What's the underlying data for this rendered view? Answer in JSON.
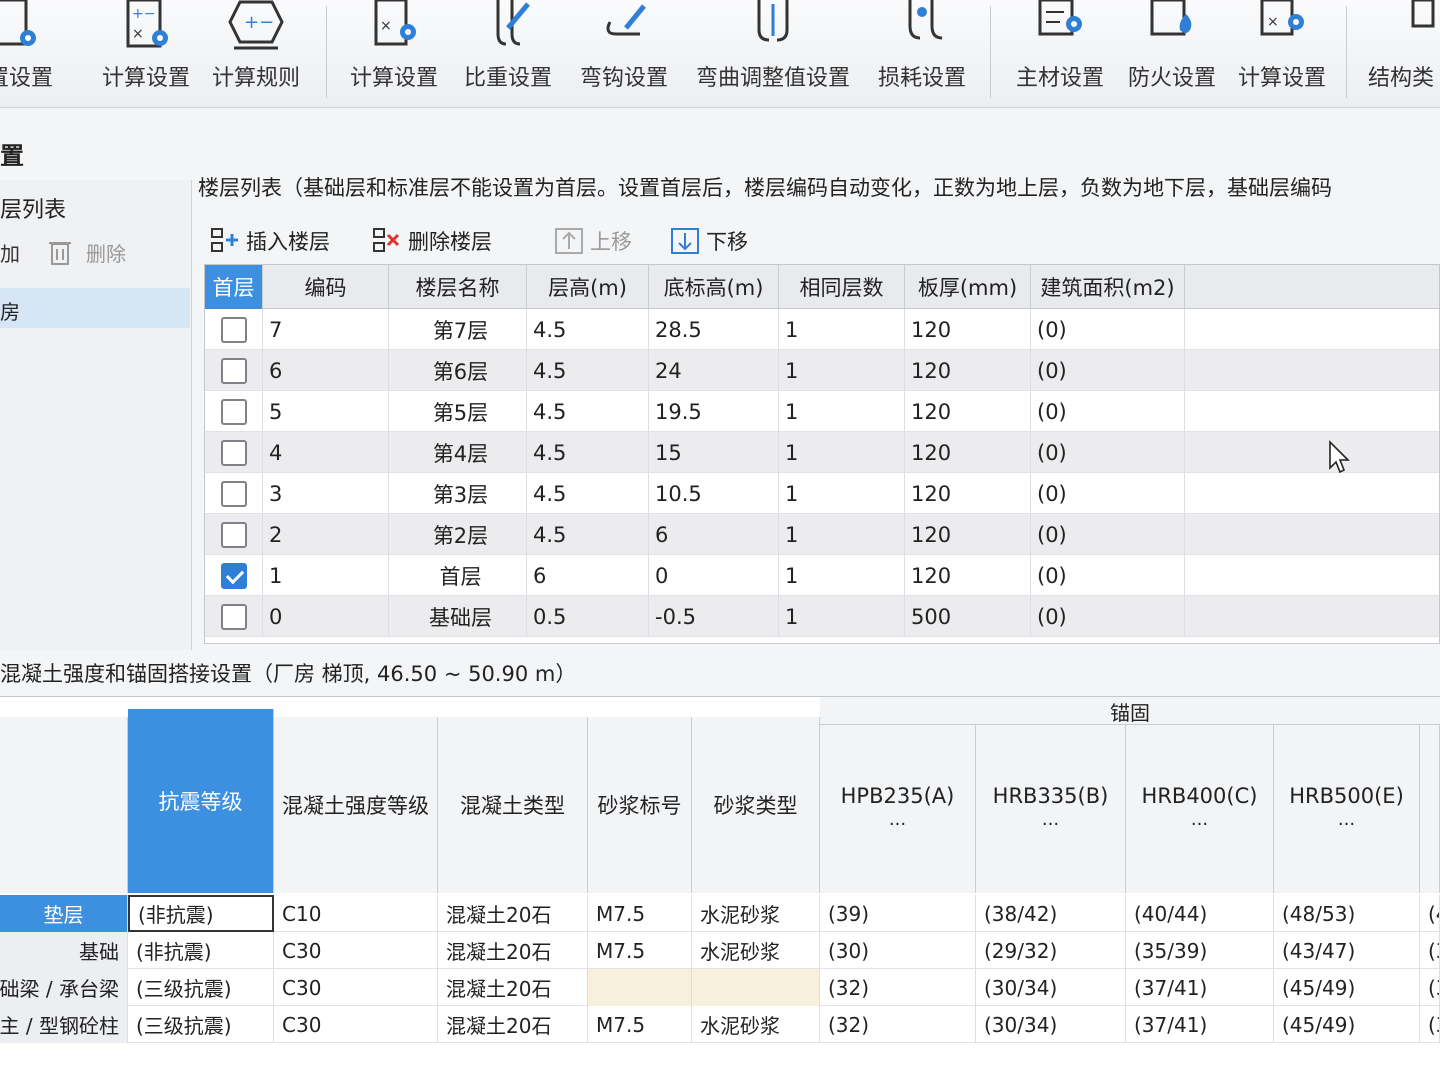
{
  "ribbon": {
    "buttons": [
      {
        "label": "置设置",
        "icon": "gear-doc-icon"
      },
      {
        "label": "计算设置",
        "icon": "calc-settings-icon"
      },
      {
        "label": "计算规则",
        "icon": "calc-rule-icon"
      },
      {
        "label": "计算设置",
        "icon": "calc-settings-icon"
      },
      {
        "label": "比重设置",
        "icon": "rebar-weight-icon"
      },
      {
        "label": "弯钩设置",
        "icon": "hook-icon"
      },
      {
        "label": "弯曲调整值设置",
        "icon": "bend-adjust-icon"
      },
      {
        "label": "损耗设置",
        "icon": "loss-icon"
      },
      {
        "label": "主材设置",
        "icon": "main-material-icon"
      },
      {
        "label": "防火设置",
        "icon": "fire-icon"
      },
      {
        "label": "计算设置",
        "icon": "calc-settings-icon"
      },
      {
        "label": "结构类",
        "icon": "structure-icon"
      }
    ]
  },
  "section_title": "置",
  "left_panel": {
    "title": "层列表",
    "add_label": "加",
    "delete_label": "删除",
    "selected_item": "房"
  },
  "floor_notice": "楼层列表（基础层和标准层不能设置为首层。设置首层后，楼层编码自动变化，正数为地上层，负数为地下层，基础层编码",
  "floor_toolbar": {
    "insert": "插入楼层",
    "delete": "删除楼层",
    "up": "上移",
    "down": "下移"
  },
  "floor_table": {
    "headers": [
      "首层",
      "编码",
      "楼层名称",
      "层高(m)",
      "底标高(m)",
      "相同层数",
      "板厚(mm)",
      "建筑面积(m2)"
    ],
    "rows": [
      {
        "first": false,
        "code": "7",
        "name": "第7层",
        "height": "4.5",
        "base": "28.5",
        "same": "1",
        "slab": "120",
        "area": "(0)"
      },
      {
        "first": false,
        "code": "6",
        "name": "第6层",
        "height": "4.5",
        "base": "24",
        "same": "1",
        "slab": "120",
        "area": "(0)"
      },
      {
        "first": false,
        "code": "5",
        "name": "第5层",
        "height": "4.5",
        "base": "19.5",
        "same": "1",
        "slab": "120",
        "area": "(0)"
      },
      {
        "first": false,
        "code": "4",
        "name": "第4层",
        "height": "4.5",
        "base": "15",
        "same": "1",
        "slab": "120",
        "area": "(0)"
      },
      {
        "first": false,
        "code": "3",
        "name": "第3层",
        "height": "4.5",
        "base": "10.5",
        "same": "1",
        "slab": "120",
        "area": "(0)"
      },
      {
        "first": false,
        "code": "2",
        "name": "第2层",
        "height": "4.5",
        "base": "6",
        "same": "1",
        "slab": "120",
        "area": "(0)"
      },
      {
        "first": true,
        "code": "1",
        "name": "首层",
        "height": "6",
        "base": "0",
        "same": "1",
        "slab": "120",
        "area": "(0)"
      },
      {
        "first": false,
        "code": "0",
        "name": "基础层",
        "height": "0.5",
        "base": "-0.5",
        "same": "1",
        "slab": "500",
        "area": "(0)"
      }
    ]
  },
  "concrete": {
    "title": "混凝土强度和锚固搭接设置（厂房  梯顶, 46.50 ~ 50.90 m）",
    "group_label": "锚固",
    "headers": {
      "seismic": "抗震等级",
      "strength": "混凝土强度等级",
      "type": "混凝土类型",
      "mortar_grade": "砂浆标号",
      "mortar_type": "砂浆类型",
      "hpb235": "HPB235(A)",
      "hrb335": "HRB335(B)",
      "hrb400": "HRB400(C)",
      "hrb500": "HRB500(E)",
      "dots": "···"
    },
    "rows": [
      {
        "name": "垫层",
        "seismic": "(非抗震)",
        "strength": "C10",
        "type": "混凝土20石",
        "mortar_grade": "M7.5",
        "mortar_type": "水泥砂浆",
        "a": "(39)",
        "b": "(38/42)",
        "c": "(40/44)",
        "e": "(48/53)",
        "more": "(4"
      },
      {
        "name": "基础",
        "seismic": "(非抗震)",
        "strength": "C30",
        "type": "混凝土20石",
        "mortar_grade": "M7.5",
        "mortar_type": "水泥砂浆",
        "a": "(30)",
        "b": "(29/32)",
        "c": "(35/39)",
        "e": "(43/47)",
        "more": "(3"
      },
      {
        "name": "础梁 / 承台梁",
        "seismic": "(三级抗震)",
        "strength": "C30",
        "type": "混凝土20石",
        "mortar_grade": "",
        "mortar_type": "",
        "a": "(32)",
        "b": "(30/34)",
        "c": "(37/41)",
        "e": "(45/49)",
        "more": "(3"
      },
      {
        "name": "主 / 型钢砼柱",
        "seismic": "(三级抗震)",
        "strength": "C30",
        "type": "混凝土20石",
        "mortar_grade": "M7.5",
        "mortar_type": "水泥砂浆",
        "a": "(32)",
        "b": "(30/34)",
        "c": "(37/41)",
        "e": "(45/49)",
        "more": "(3"
      }
    ]
  }
}
